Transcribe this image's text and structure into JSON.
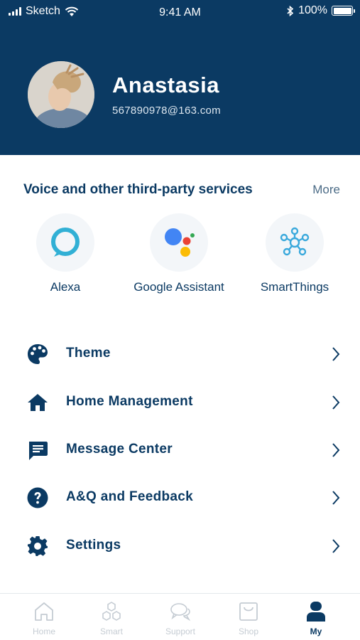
{
  "status_bar": {
    "carrier": "Sketch",
    "time": "9:41 AM",
    "battery": "100%",
    "icons": [
      "signal-icon",
      "wifi-icon",
      "bluetooth-icon",
      "battery-icon"
    ]
  },
  "profile": {
    "name": "Anastasia",
    "email": "567890978@163.com"
  },
  "services": {
    "title": "Voice and other third-party services",
    "more": "More",
    "items": [
      {
        "label": "Alexa",
        "icon": "alexa-icon"
      },
      {
        "label": "Google Assistant",
        "icon": "google-assistant-icon"
      },
      {
        "label": "SmartThings",
        "icon": "smartthings-icon"
      }
    ]
  },
  "menu": [
    {
      "label": "Theme",
      "icon": "palette-icon"
    },
    {
      "label": "Home Management",
      "icon": "home-icon"
    },
    {
      "label": "Message Center",
      "icon": "message-icon"
    },
    {
      "label": "A&Q and Feedback",
      "icon": "help-icon"
    },
    {
      "label": "Settings",
      "icon": "gear-icon"
    }
  ],
  "tabs": [
    {
      "label": "Home",
      "icon": "home-outline-icon",
      "active": false
    },
    {
      "label": "Smart",
      "icon": "smart-hexagon-icon",
      "active": false
    },
    {
      "label": "Support",
      "icon": "chat-bubbles-icon",
      "active": false
    },
    {
      "label": "Shop",
      "icon": "shopping-bag-icon",
      "active": false
    },
    {
      "label": "My",
      "icon": "person-icon",
      "active": true
    }
  ],
  "colors": {
    "primary": "#0b3a63",
    "alexa": "#31b0d5",
    "google_blue": "#4285f4",
    "google_red": "#ea4335",
    "google_yellow": "#fbbc05",
    "google_green": "#34a853",
    "smartthings": "#3aa9dc",
    "inactive_tab": "#c5ccd3"
  }
}
